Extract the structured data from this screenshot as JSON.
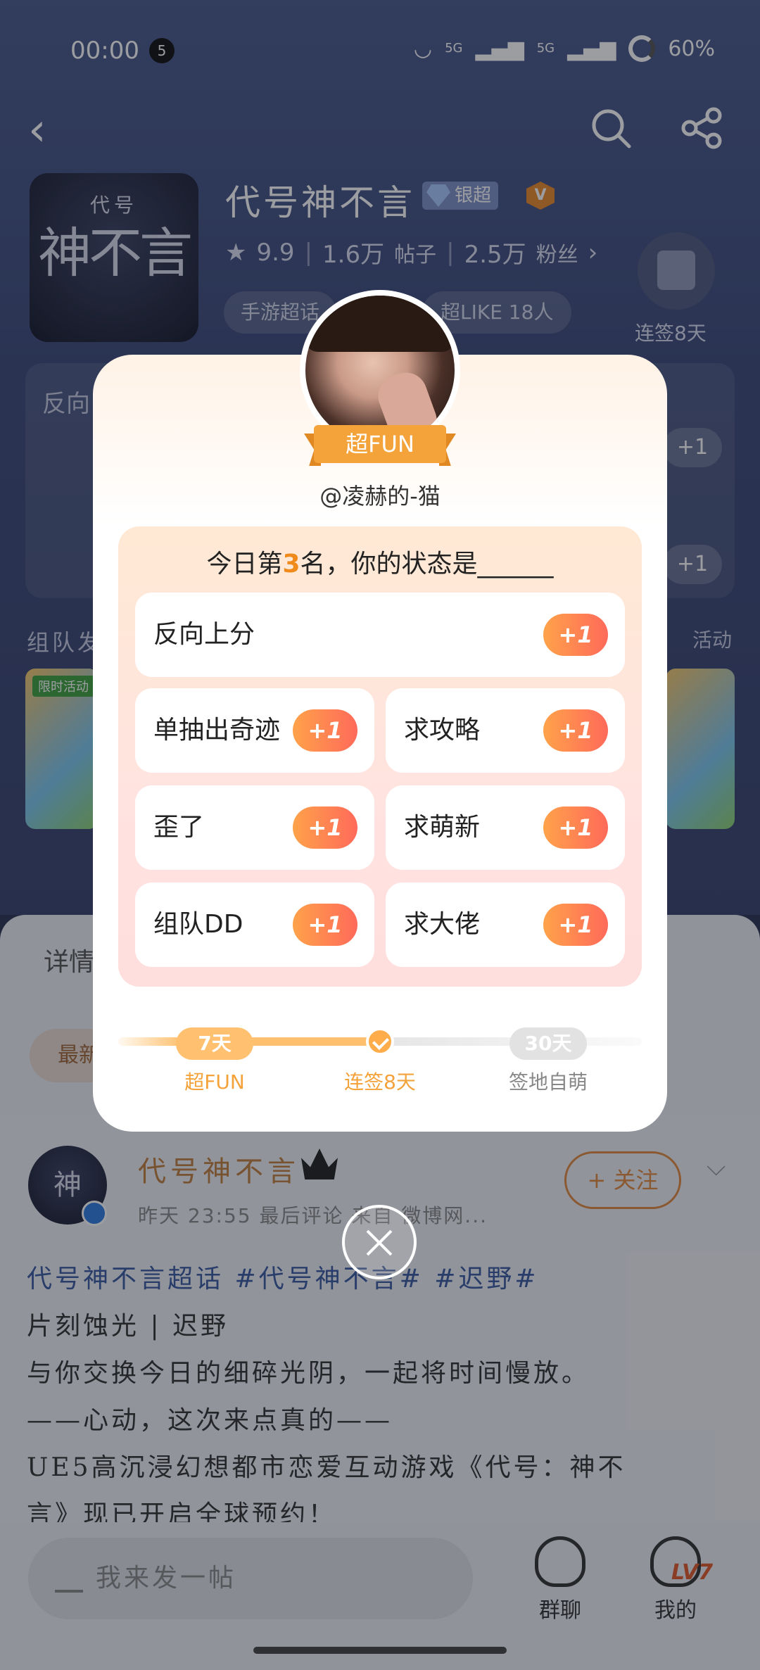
{
  "status_bar": {
    "time": "00:00",
    "notification_count": "5",
    "signal_1": "5G",
    "signal_2": "5G",
    "battery": "60%"
  },
  "topic": {
    "cover_small": "代号",
    "cover_big": "神不言",
    "title": "代号神不言",
    "badge": "银超",
    "verified": "V",
    "rating": "9.9",
    "posts_count": "1.6万",
    "posts_label": "帖子",
    "fans_count": "2.5万",
    "fans_label": "粉丝",
    "tag": "手游超话",
    "like_tag": "超LIKE 18人",
    "checkin_label": "连签8天"
  },
  "background": {
    "card_text": "反向",
    "plus": "+1",
    "team_label": "组队发",
    "more_activity": "活动",
    "banner_label": "限时活动",
    "tab_detail": "详情",
    "sort_label": "最新"
  },
  "post": {
    "author": "代号神不言",
    "meta": "昨天 23:55 最后评论  来自 微博网...",
    "follow": "+ 关注",
    "line1_prefix": "代号神不言超话",
    "line1_tags": " #代号神不言# #迟野#",
    "line2": "片刻蚀光 | 迟野",
    "line3": "与你交换今日的细碎光阴，一起将时间慢放。",
    "line4": "——心动，这次来点真的——",
    "line5": "UE5高沉浸幻想都市恋爱互动游戏《代号：神不",
    "line6": "言》现已开启全球预约！"
  },
  "bottom_bar": {
    "composer_placeholder": "我来发一帖",
    "group_chat": "群聊",
    "mine": "我的",
    "level": "LV7"
  },
  "modal": {
    "ribbon": "超FUN",
    "username": "@凌赫的-猫",
    "title_prefix": "今日第",
    "rank": "3",
    "title_suffix": "名，你的状态是______",
    "options": [
      {
        "label": "反向上分",
        "plus": "+1"
      },
      {
        "label": "单抽出奇迹",
        "plus": "+1"
      },
      {
        "label": "求攻略",
        "plus": "+1"
      },
      {
        "label": "歪了",
        "plus": "+1"
      },
      {
        "label": "求萌新",
        "plus": "+1"
      },
      {
        "label": "组队DD",
        "plus": "+1"
      },
      {
        "label": "求大佬",
        "plus": "+1"
      }
    ],
    "milestones": [
      {
        "pill": "7天",
        "label": "超FUN"
      },
      {
        "label": "连签8天"
      },
      {
        "pill": "30天",
        "label": "签地自萌"
      }
    ]
  },
  "colors": {
    "accent_orange": "#f4a23a",
    "plus_gradient_start": "#ffa24a",
    "plus_gradient_end": "#ff6a5a",
    "header_blue": "#3c4a78"
  }
}
